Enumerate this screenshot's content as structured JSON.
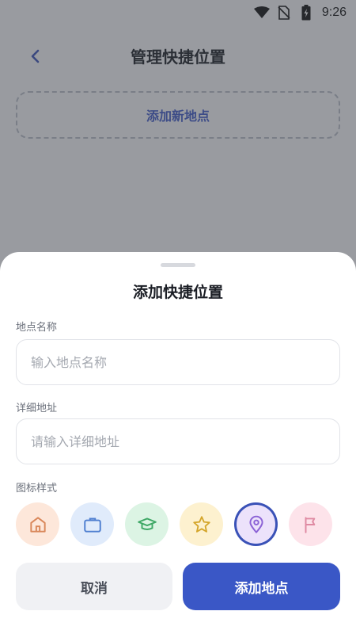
{
  "status_bar": {
    "time": "9:26"
  },
  "header": {
    "title": "管理快捷位置"
  },
  "add_new": {
    "label": "添加新地点"
  },
  "sheet": {
    "title": "添加快捷位置",
    "name_field": {
      "label": "地点名称",
      "placeholder": "输入地点名称",
      "value": ""
    },
    "address_field": {
      "label": "详细地址",
      "placeholder": "请输入详细地址",
      "value": ""
    },
    "icon_style": {
      "label": "图标样式",
      "options": [
        {
          "icon": "home-icon",
          "bg": "#fde7da",
          "color": "#d9875a"
        },
        {
          "icon": "briefcase-icon",
          "bg": "#e0ebfb",
          "color": "#4f7fd0"
        },
        {
          "icon": "graduation-cap-icon",
          "bg": "#dcf4e4",
          "color": "#3fa866"
        },
        {
          "icon": "star-icon",
          "bg": "#fdf1cf",
          "color": "#d4a52a"
        },
        {
          "icon": "map-pin-icon",
          "bg": "#ece2fb",
          "color": "#8b62d6",
          "selected": true
        },
        {
          "icon": "flag-icon",
          "bg": "#fde3ea",
          "color": "#df8aa2"
        }
      ]
    },
    "cancel_label": "取消",
    "confirm_label": "添加地点"
  }
}
